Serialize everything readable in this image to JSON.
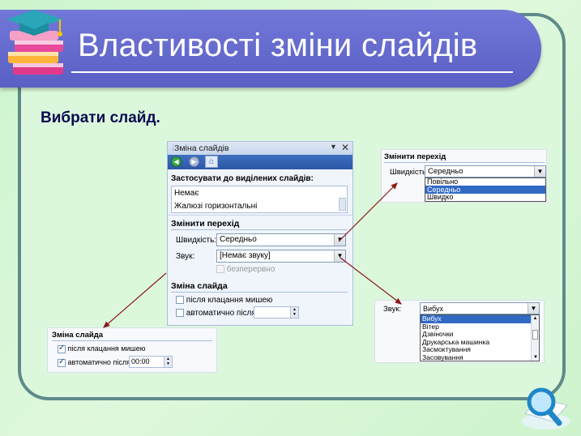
{
  "slide": {
    "title": "Властивості зміни слайдів",
    "subtitle": "Вибрати слайд."
  },
  "task_pane": {
    "title": "Зміна слайдів",
    "apply_header": "Застосувати до виділених слайдів:",
    "transitions": [
      "Немає",
      "Жалюзі горизонтальні"
    ],
    "modify_header": "Змінити перехід",
    "speed_label": "Швидкість:",
    "speed_value": "Середньо",
    "sound_label": "Звук:",
    "sound_value": "[Немає звуку]",
    "loop_label": "безперервно",
    "advance_header": "Зміна слайда",
    "on_click_label": "після клацання мишею",
    "auto_label": "автоматично після",
    "auto_value": ""
  },
  "speed_popup": {
    "header": "Змінити перехід",
    "label": "Швидкість:",
    "value": "Середньо",
    "options": [
      "Повільно",
      "Середньо",
      "Швидко"
    ],
    "selected": "Середньо"
  },
  "sound_popup": {
    "label": "Звук:",
    "value": "Вибух",
    "options": [
      "Вибух",
      "Вітер",
      "Дзвіночки",
      "Друкарська машинка",
      "Засмоктування",
      "Засовування"
    ],
    "selected": "Вибух"
  },
  "advance_popup": {
    "header": "Зміна слайда",
    "on_click_label": "після клацання мишею",
    "auto_label": "автоматично після",
    "auto_value": "00:00"
  },
  "colors": {
    "background": "#d6f5d6",
    "title_bar": "#6268cc",
    "frame": "#5f8a8a",
    "arrow": "#8b1a1a",
    "selection": "#316ac5"
  }
}
